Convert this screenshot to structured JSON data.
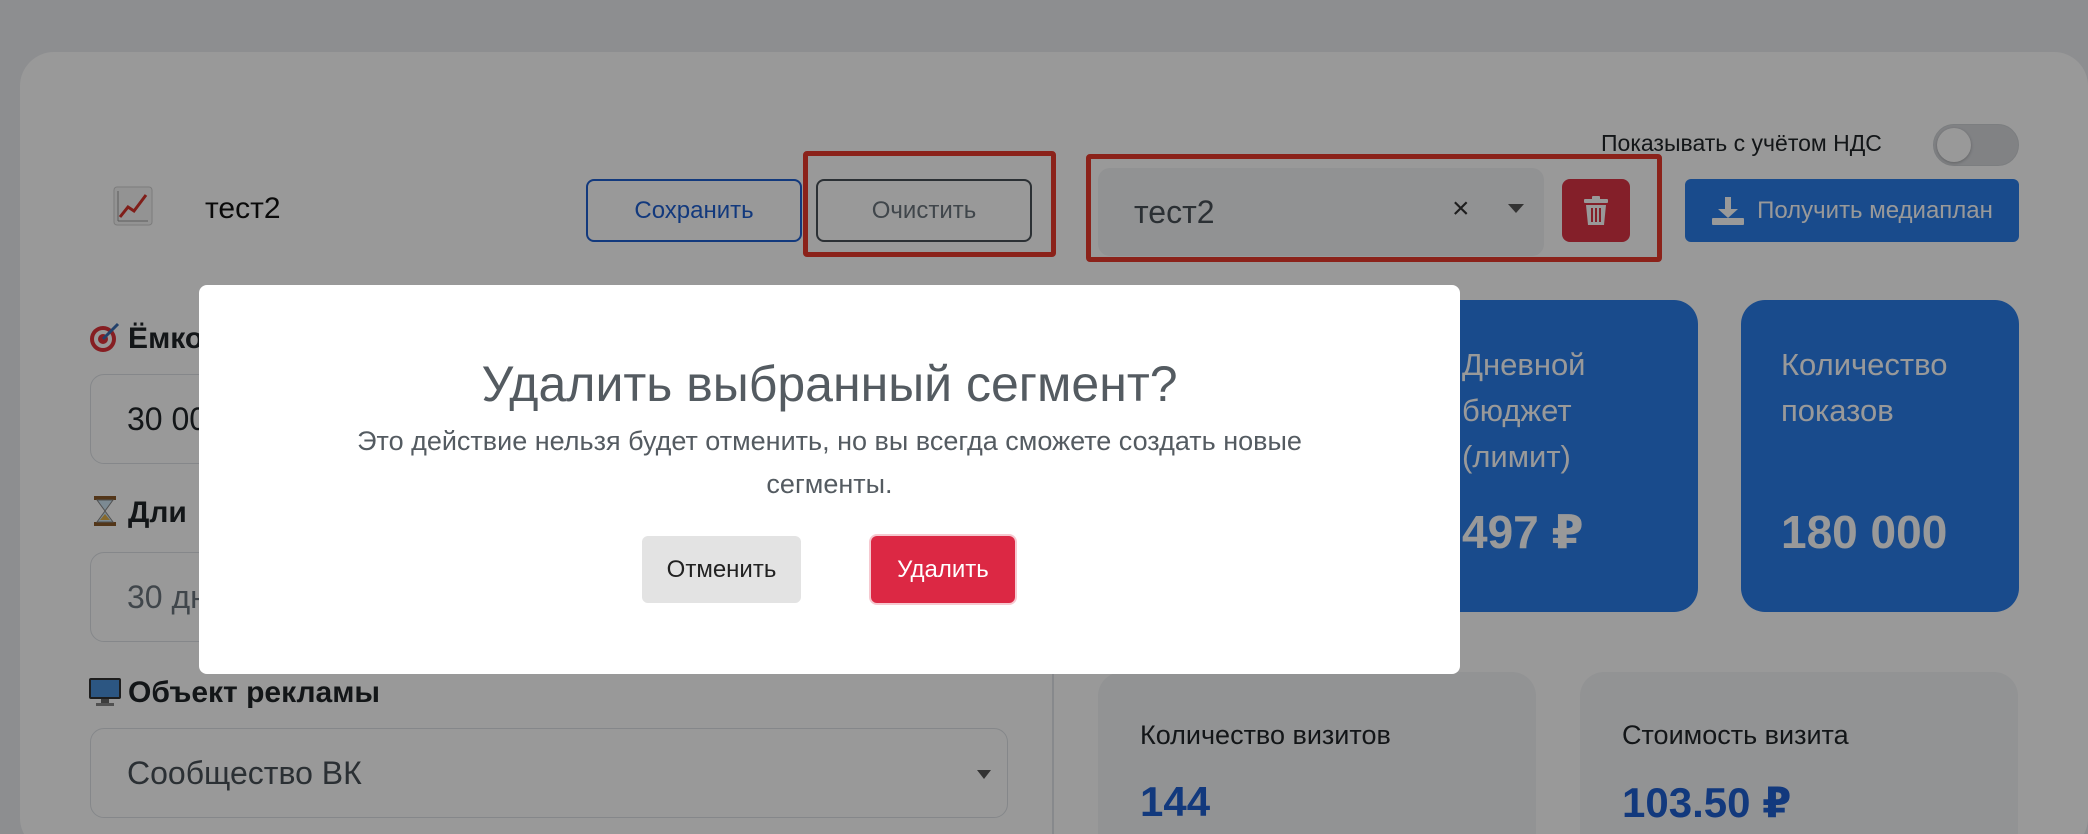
{
  "header": {
    "vat_label": "Показывать с учётом НДС",
    "vat_toggle_on": false,
    "segment_title": "тест2",
    "chart_icon": "chart-increasing-icon",
    "save_label": "Сохранить",
    "clear_label": "Очистить",
    "segment_select_value": "тест2",
    "clear_select_glyph": "×",
    "trash_icon": "trash-icon",
    "mediaplan_label": "Получить медиаплан",
    "mediaplan_icon": "download-icon"
  },
  "form": {
    "capacity_label": "Ёмко",
    "capacity_icon": "target-icon",
    "capacity_value": "30 00",
    "duration_label": "Дли",
    "duration_icon": "hourglass-icon",
    "duration_value": "30 дн",
    "ad_object_label": "Объект рекламы",
    "ad_object_icon": "computer-icon",
    "ad_object_value": "Сообщество ВК"
  },
  "stats": {
    "daily_budget_title": "Дневной бюджет (лимит)",
    "daily_budget_value": "497 ₽",
    "impressions_title": "Количество показов",
    "impressions_value": "180 000",
    "visits_title": "Количество визитов",
    "visits_value": "144",
    "visit_cost_title": "Стоимость визита",
    "visit_cost_value": "103.50 ₽"
  },
  "modal": {
    "title": "Удалить выбранный сегмент?",
    "text": "Это действие нельзя будет отменить, но вы всегда сможете создать новые сегменты.",
    "cancel_label": "Отменить",
    "delete_label": "Удалить"
  },
  "colors": {
    "primary": "#2b7de9",
    "danger": "#dc3545",
    "highlight": "#e8392c"
  }
}
